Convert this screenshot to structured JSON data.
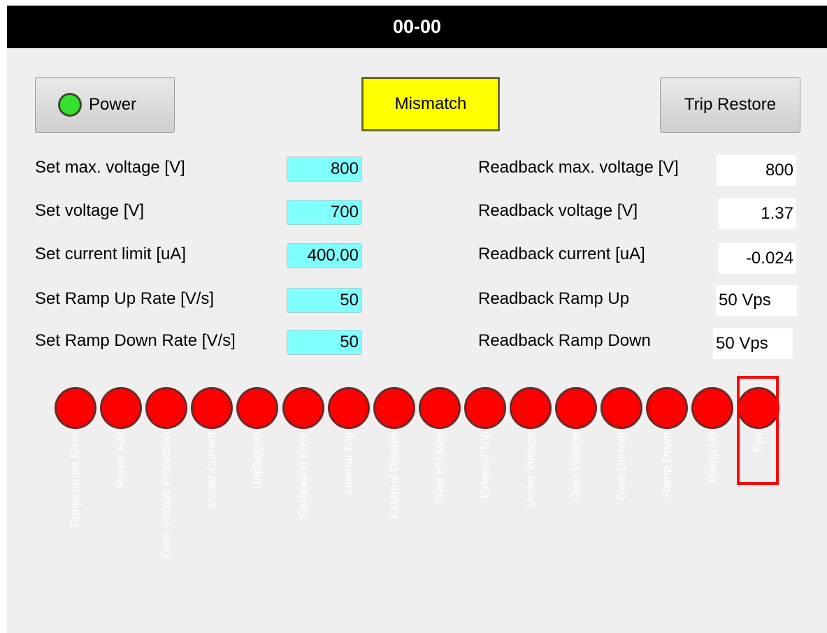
{
  "window": {
    "title": "00-00"
  },
  "buttons": {
    "power": "Power",
    "trip_restore": "Trip Restore"
  },
  "status": {
    "mismatch": "Mismatch"
  },
  "settings": [
    {
      "label": "Set max. voltage [V]",
      "value": "800"
    },
    {
      "label": "Set voltage [V]",
      "value": "700"
    },
    {
      "label": "Set current limit [uA]",
      "value": "400.00"
    },
    {
      "label": "Set Ramp Up Rate [V/s]",
      "value": "50"
    },
    {
      "label": "Set Ramp Down Rate [V/s]",
      "value": "50"
    }
  ],
  "readbacks": [
    {
      "label": "Readback max. voltage [V]",
      "value": "800"
    },
    {
      "label": "Readback voltage [V]",
      "value": "1.37"
    },
    {
      "label": "Readback current [uA]",
      "value": "-0.024"
    },
    {
      "label": "Readback Ramp Up",
      "value": "50 Vps"
    },
    {
      "label": "Readback Ramp Down",
      "value": "50 Vps"
    }
  ],
  "status_leds": [
    "Temperature Error",
    "Power Fail",
    "Over Voltage Protection",
    "Under Current",
    "Unplugged",
    "Calibration Error",
    "Internal Trip",
    "External Disable",
    "Over HV Max",
    "External Trip",
    "Under Voltage",
    "Over Voltage",
    "Over Current",
    "Ramp Down",
    "Ramp Up",
    "Pwr"
  ],
  "colors": {
    "power_led": "#33e02d",
    "status_led": "#ff0000",
    "mismatch_bg": "#ffff00",
    "set_field_bg": "#80ffff",
    "highlight": "#ff0000"
  }
}
